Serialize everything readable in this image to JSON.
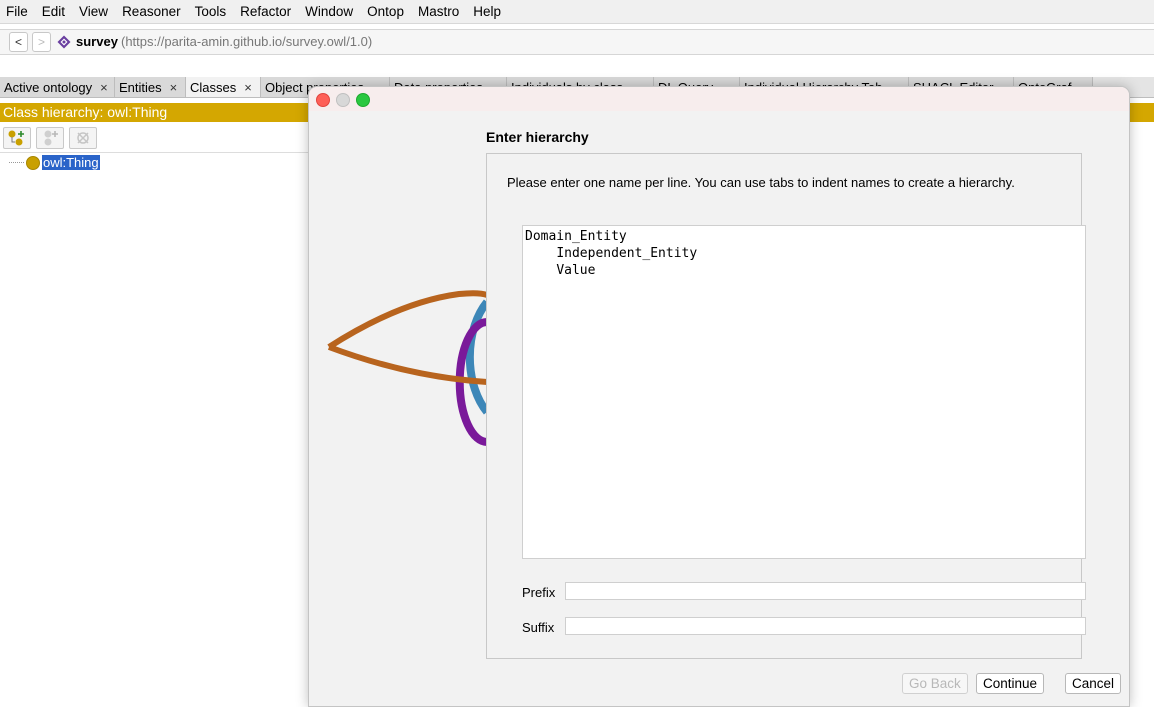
{
  "menu": [
    "File",
    "Edit",
    "View",
    "Reasoner",
    "Tools",
    "Refactor",
    "Window",
    "Ontop",
    "Mastro",
    "Help"
  ],
  "address": {
    "back": "<",
    "forward": ">",
    "ontology_name": "survey",
    "ontology_iri": "(https://parita-amin.github.io/survey.owl/1.0)"
  },
  "tabs": [
    {
      "label": "Active ontology",
      "close": "×",
      "active": false
    },
    {
      "label": "Entities",
      "close": "×",
      "active": false
    },
    {
      "label": "Classes",
      "close": "×",
      "active": true
    },
    {
      "label": "Object properties",
      "close": "",
      "active": false
    },
    {
      "label": "Data properties",
      "close": "",
      "active": false
    },
    {
      "label": "Individuals by class",
      "close": "",
      "active": false
    },
    {
      "label": "DL Query",
      "close": "",
      "active": false
    },
    {
      "label": "Individual Hierarchy Tab",
      "close": "",
      "active": false
    },
    {
      "label": "SHACL Editor",
      "close": "",
      "active": false
    },
    {
      "label": "OntoGraf",
      "close": "",
      "active": false
    }
  ],
  "panel": {
    "title": "Class hierarchy: owl:Thing",
    "tree_root": "owl:Thing"
  },
  "dialog": {
    "heading": "Enter hierarchy",
    "instructions": "Please enter one name per line. You can use tabs to indent names to create a hierarchy.",
    "hierarchy_text": "Domain_Entity\n\tIndependent_Entity\n\tValue",
    "prefix_label": "Prefix",
    "prefix_value": "",
    "suffix_label": "Suffix",
    "suffix_value": "",
    "go_back": "Go Back",
    "continue": "Continue",
    "cancel": "Cancel"
  },
  "colors": {
    "panel_header": "#d4a701",
    "selection": "#2a64c9",
    "class_icon": "#c9a000"
  }
}
